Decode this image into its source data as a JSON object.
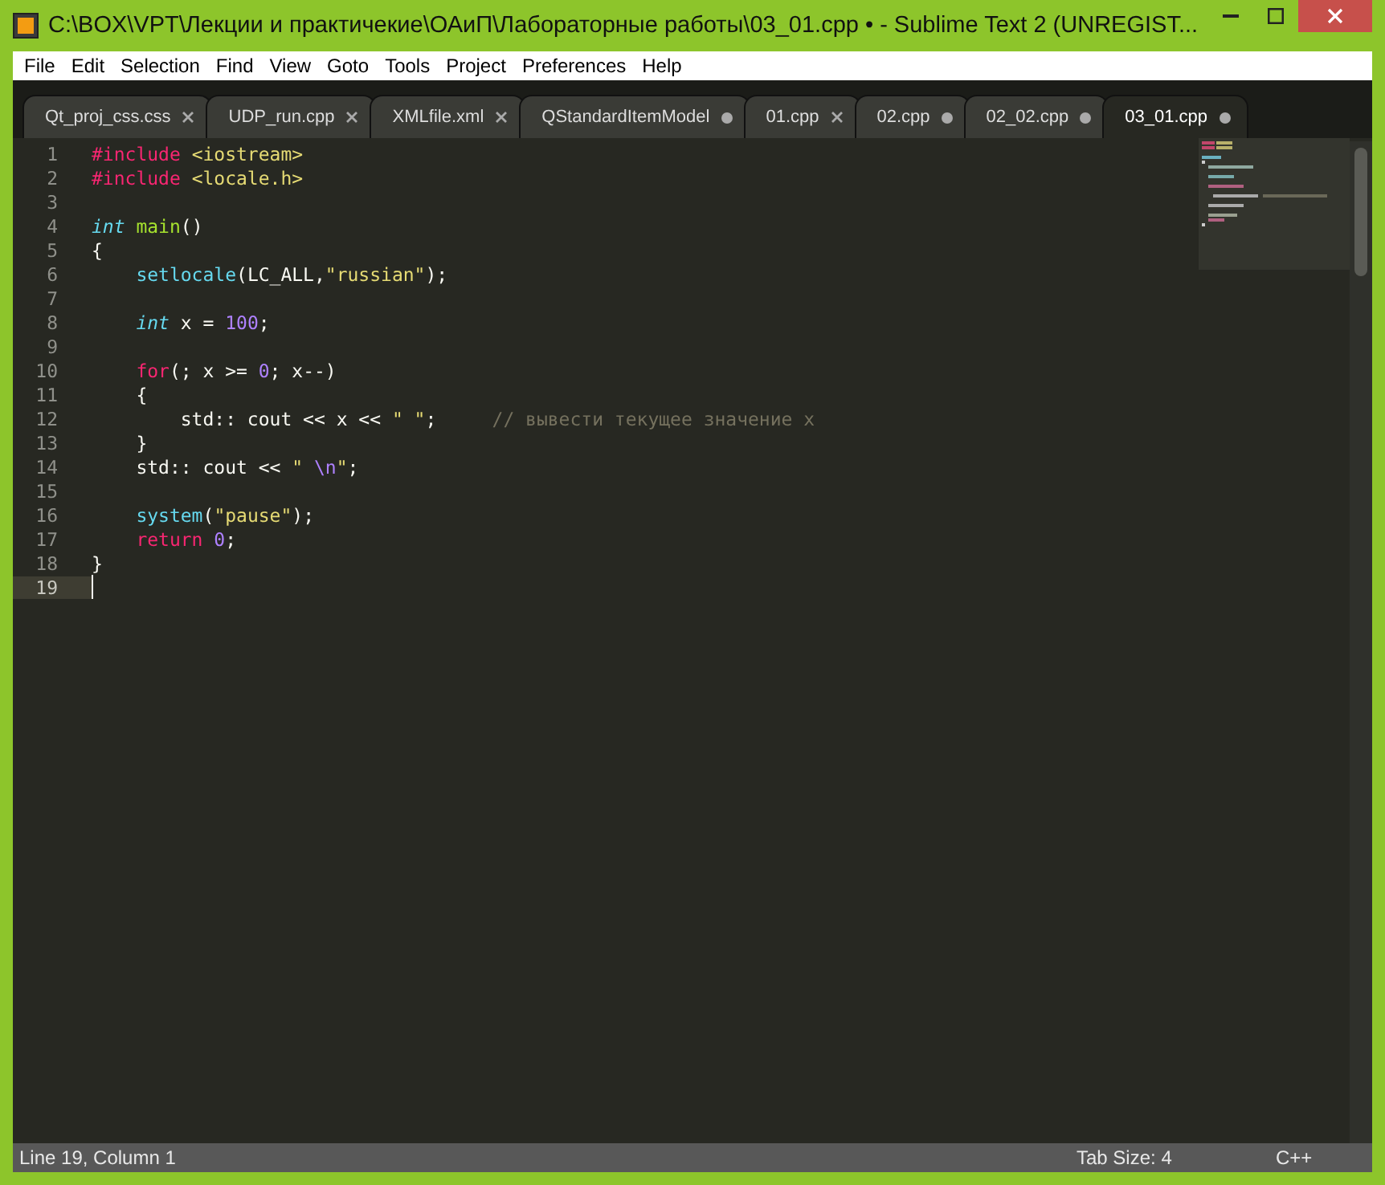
{
  "window": {
    "title": "C:\\BOX\\VPT\\Лекции и практичекие\\ОАиП\\Лабораторные работы\\03_01.cpp • - Sublime Text 2 (UNREGIST..."
  },
  "menu": [
    "File",
    "Edit",
    "Selection",
    "Find",
    "View",
    "Goto",
    "Tools",
    "Project",
    "Preferences",
    "Help"
  ],
  "tabs": [
    {
      "label": "Qt_proj_css.css",
      "modified": false,
      "selected": false
    },
    {
      "label": "UDP_run.cpp",
      "modified": false,
      "selected": false
    },
    {
      "label": "XMLfile.xml",
      "modified": false,
      "selected": false
    },
    {
      "label": "QStandardItemModel",
      "modified": true,
      "selected": false
    },
    {
      "label": "01.cpp",
      "modified": false,
      "selected": false
    },
    {
      "label": "02.cpp",
      "modified": true,
      "selected": false
    },
    {
      "label": "02_02.cpp",
      "modified": true,
      "selected": false
    },
    {
      "label": "03_01.cpp",
      "modified": true,
      "selected": true
    }
  ],
  "editor": {
    "lines": [
      {
        "number": "1",
        "current": false,
        "tokens": [
          {
            "kind": "keyword",
            "text": "#include"
          },
          {
            "kind": "string",
            "text": " <iostream>"
          }
        ]
      },
      {
        "number": "2",
        "current": false,
        "tokens": [
          {
            "kind": "keyword",
            "text": "#include"
          },
          {
            "kind": "string",
            "text": " <locale.h>"
          }
        ]
      },
      {
        "number": "3",
        "current": false
      },
      {
        "number": "4",
        "current": false,
        "tokens": [
          {
            "kind": "type",
            "text": "int"
          },
          {
            "kind": "function",
            "text": " main"
          },
          {
            "kind": "plain",
            "text": "()"
          }
        ]
      },
      {
        "number": "5",
        "current": false,
        "tokens": [
          {
            "kind": "plain",
            "text": "{"
          }
        ]
      },
      {
        "number": "6",
        "current": false,
        "tokens": [
          {
            "kind": "call",
            "text": "    setlocale"
          },
          {
            "kind": "plain",
            "text": "(LC_ALL,"
          },
          {
            "kind": "string",
            "text": "\"russian\""
          },
          {
            "kind": "plain",
            "text": ");"
          }
        ]
      },
      {
        "number": "7",
        "current": false
      },
      {
        "number": "8",
        "current": false,
        "tokens": [
          {
            "kind": "type",
            "text": "    int"
          },
          {
            "kind": "plain",
            "text": " x = "
          },
          {
            "kind": "number",
            "text": "100"
          },
          {
            "kind": "plain",
            "text": ";"
          }
        ]
      },
      {
        "number": "9",
        "current": false
      },
      {
        "number": "10",
        "current": false,
        "tokens": [
          {
            "kind": "keyword",
            "text": "    for"
          },
          {
            "kind": "plain",
            "text": "(; x >= "
          },
          {
            "kind": "number",
            "text": "0"
          },
          {
            "kind": "plain",
            "text": "; x--)"
          }
        ]
      },
      {
        "number": "11",
        "current": false,
        "tokens": [
          {
            "kind": "plain",
            "text": "    {"
          }
        ]
      },
      {
        "number": "12",
        "current": false,
        "tokens": [
          {
            "kind": "plain",
            "text": "        std:: cout << x << "
          },
          {
            "kind": "string",
            "text": "\" \""
          },
          {
            "kind": "plain",
            "text": ";     "
          },
          {
            "kind": "comment",
            "text": "// вывести текущее значение x"
          }
        ]
      },
      {
        "number": "13",
        "current": false,
        "tokens": [
          {
            "kind": "plain",
            "text": "    }"
          }
        ]
      },
      {
        "number": "14",
        "current": false,
        "tokens": [
          {
            "kind": "plain",
            "text": "    std:: cout << "
          },
          {
            "kind": "string",
            "text": "\" "
          },
          {
            "kind": "escape",
            "text": "\\n"
          },
          {
            "kind": "string",
            "text": "\""
          },
          {
            "kind": "plain",
            "text": ";"
          }
        ]
      },
      {
        "number": "15",
        "current": false
      },
      {
        "number": "16",
        "current": false,
        "tokens": [
          {
            "kind": "call",
            "text": "    system"
          },
          {
            "kind": "plain",
            "text": "("
          },
          {
            "kind": "string",
            "text": "\"pause\""
          },
          {
            "kind": "plain",
            "text": ");"
          }
        ]
      },
      {
        "number": "17",
        "current": false,
        "tokens": [
          {
            "kind": "keyword",
            "text": "    return"
          },
          {
            "kind": "number",
            "text": " 0"
          },
          {
            "kind": "plain",
            "text": ";"
          }
        ]
      },
      {
        "number": "18",
        "current": false,
        "tokens": [
          {
            "kind": "plain",
            "text": "}"
          }
        ]
      },
      {
        "number": "19",
        "current": true
      }
    ]
  },
  "status_bar": {
    "position": "Line 19, Column 1",
    "tab_size": "Tab Size: 4",
    "syntax": "C++"
  }
}
